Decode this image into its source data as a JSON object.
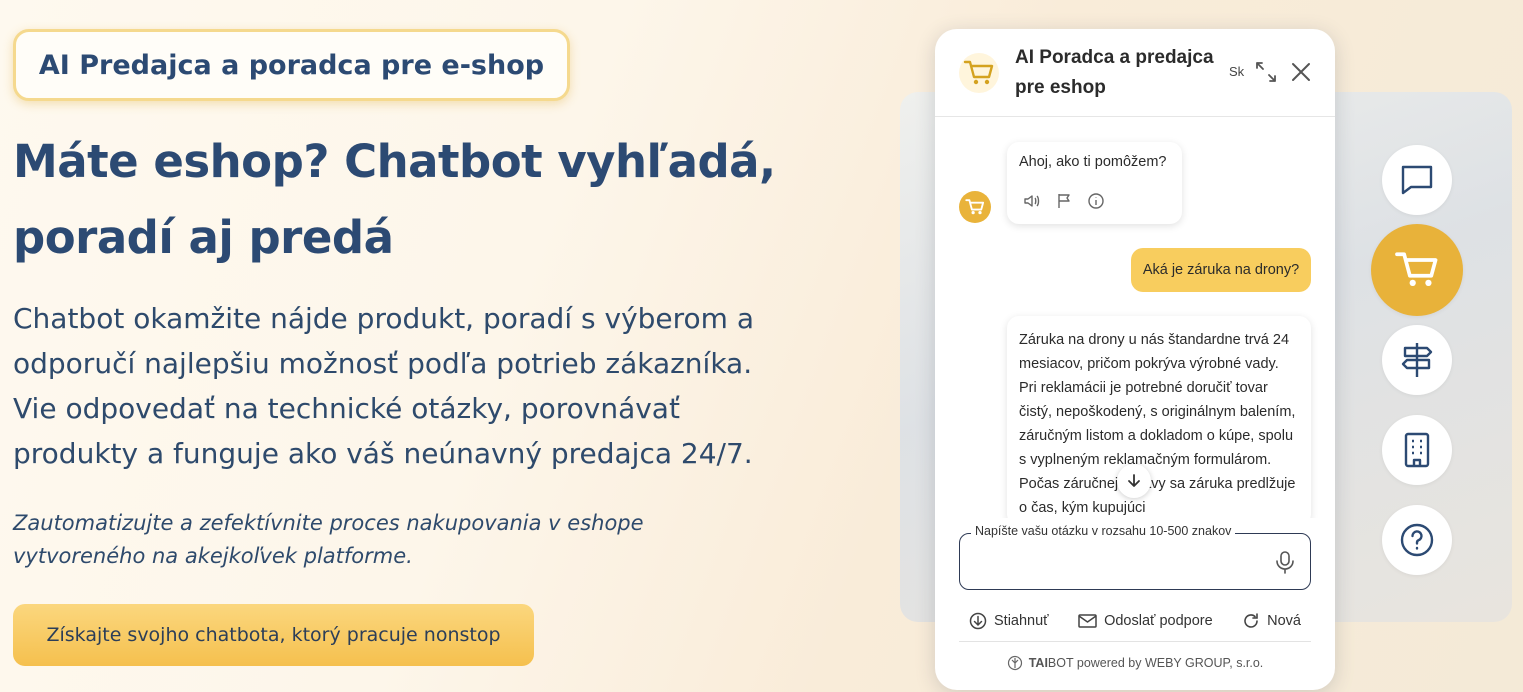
{
  "badge": "AI Predajca a poradca pre e-shop",
  "headline": {
    "line1": "Máte eshop? Chatbot vyhľadá,",
    "line2": "poradí aj predá"
  },
  "description": [
    "Chatbot okamžite nájde produkt, poradí s výberom a",
    "odporučí najlepšiu možnosť podľa potrieb zákazníka.",
    "Vie odpovedať na technické otázky, porovnávať",
    "produkty a funguje ako váš neúnavný predajca 24/7."
  ],
  "tagline": {
    "line1": "Zautomatizujte a zefektívnite proces nakupovania v eshope",
    "line2": "vytvoreného na akejkoľvek platforme."
  },
  "cta_label": "Získajte svojho chatbota, ktorý pracuje nonstop",
  "chat": {
    "title": "AI Poradca a predajca pre eshop",
    "language": "Sk",
    "messages": {
      "bot_greeting": "Ahoj, ako ti pomôžem?",
      "user_question": "Aká je záruka na drony?",
      "bot_answer": "Záruka na drony u nás štandardne trvá 24 mesiacov, pričom pokrýva výrobné vady. Pri reklamácii je potrebné doručiť tovar čistý, nepoškodený, s originálnym balením, záručným listom a dokladom o kúpe, spolu s vyplneným reklamačným formulárom. Počas záručnej opravy sa záruka predlžuje o čas, kým kupujúci"
    },
    "input": {
      "label": "Napíšte vašu otázku v rozsahu 10-500 znakov",
      "value": ""
    },
    "footer_actions": {
      "download": "Stiahnuť",
      "support": "Odoslať podpore",
      "new": "Nová"
    },
    "powered_by": {
      "brand_bold": "TAI",
      "brand_rest": "BOT powered by WEBY GROUP, s.r.o."
    }
  },
  "side_nav": [
    {
      "icon": "chat-bubble-icon",
      "active": false
    },
    {
      "icon": "cart-icon",
      "active": true
    },
    {
      "icon": "signpost-icon",
      "active": false
    },
    {
      "icon": "building-icon",
      "active": false
    },
    {
      "icon": "help-icon",
      "active": false
    }
  ],
  "colors": {
    "accent": "#f8cd5e",
    "accent_dark": "#e8b23a",
    "heading": "#2c4a73",
    "text": "#2e4a6c"
  }
}
